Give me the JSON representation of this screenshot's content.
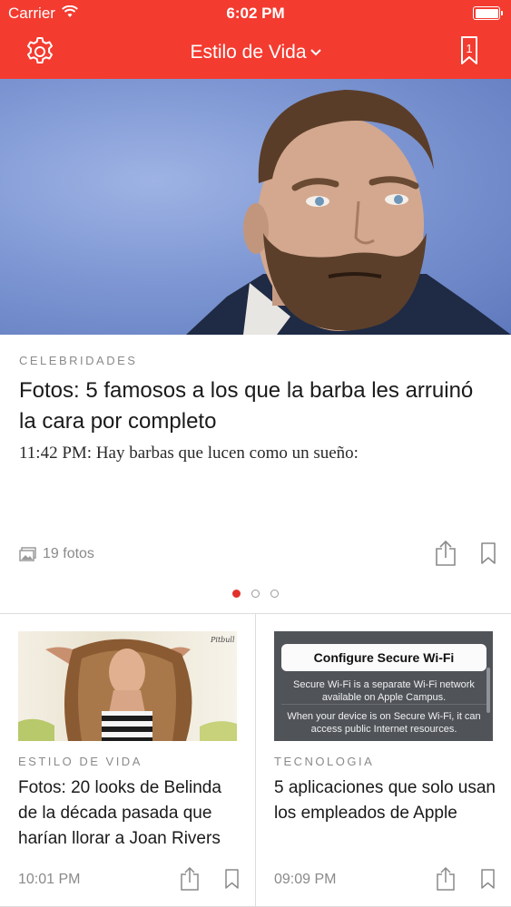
{
  "status_bar": {
    "carrier": "Carrier",
    "time": "6:02 PM"
  },
  "nav": {
    "section": "Estilo de Vida",
    "bookmark_count": "1",
    "bar_color": "#f43b30"
  },
  "hero_article": {
    "category": "CELEBRIDADES",
    "headline": "Fotos: 5 famosos a los que la barba les arruinó la cara por completo",
    "summary": "11:42 PM: Hay barbas que lucen como un sueño:",
    "photo_count": "19 fotos"
  },
  "pager": {
    "pages": 3,
    "active": 0
  },
  "cards": [
    {
      "category": "ESTILO DE VIDA",
      "title": "Fotos: 20 looks de Belinda de la década pasada que harían llorar a Joan Rivers",
      "time": "10:01 PM"
    },
    {
      "category": "TECNOLOGIA",
      "title": "5 aplicaciones que solo usan los empleados de Apple",
      "time": "09:09 PM",
      "thumb": {
        "button": "Configure Secure Wi-Fi",
        "text1": "Secure Wi-Fi is a separate Wi-Fi network available on Apple Campus.",
        "text2": "When your device is on Secure Wi-Fi, it can access public Internet resources."
      }
    }
  ],
  "icons": {
    "settings": "gear-icon",
    "bookmarks": "bookmark-icon",
    "share": "share-icon",
    "photos": "photo-icon"
  }
}
